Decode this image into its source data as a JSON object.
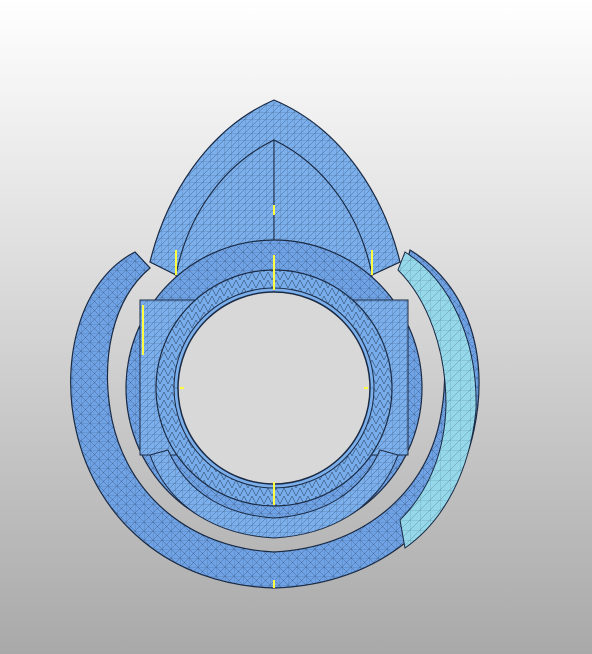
{
  "viewport": {
    "background_top": "#ffffff",
    "background_bottom": "#a9a9a9"
  },
  "model": {
    "description_icon": "mesh-model-icon",
    "surface_color": "#6fa3e6",
    "surface_light": "#9cc4f0",
    "surface_highlight": "#8fe0ea",
    "edge_color": "#1a2a44",
    "marker_color": "#ffff40"
  }
}
